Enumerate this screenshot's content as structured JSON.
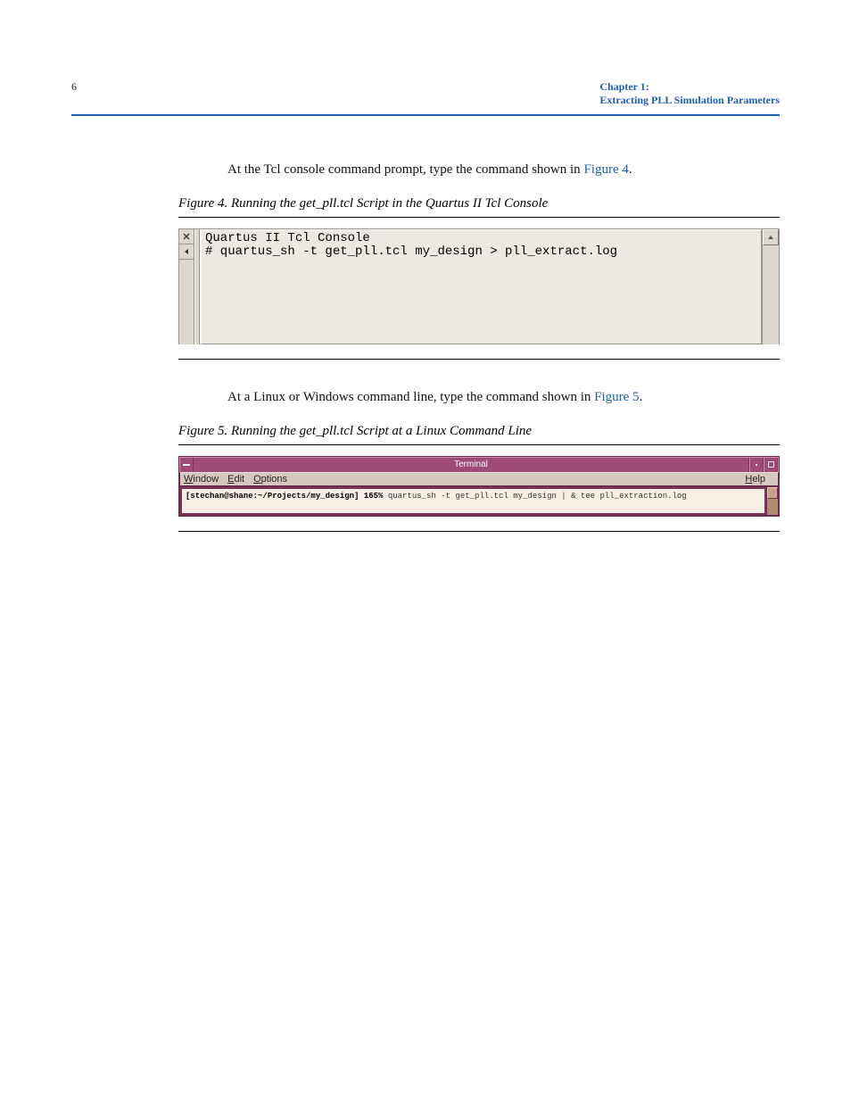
{
  "header": {
    "left": "6",
    "right_chapter": "Chapter 1:",
    "right_sub": "Extracting PLL Simulation Parameters"
  },
  "paragraphs": {
    "p1_a": "At the Tcl console command prompt, type the command shown in ",
    "p1_link": "Figure 4",
    "p1_b": ".",
    "p2_a": "At a Linux or Windows command line, type the command shown in ",
    "p2_link": "Figure 5",
    "p2_b": "."
  },
  "figures": {
    "fig4": {
      "caption": "Figure 4. Running the get_pll.tcl Script in the Quartus II Tcl Console",
      "console": {
        "line1": "Quartus II Tcl Console",
        "line2": "# quartus_sh -t get_pll.tcl my_design > pll_extract.log"
      }
    },
    "fig5": {
      "caption": "Figure 5. Running the get_pll.tcl Script at a Linux Command Line",
      "title": "Terminal",
      "menu": {
        "window": "Window",
        "edit": "Edit",
        "options": "Options",
        "help": "Help"
      },
      "prompt_bold": "[stechan@shane:~/Projects/my_design] 165%",
      "prompt_cmd": " quartus_sh -t get_pll.tcl my_design | & tee pll_extraction.log"
    }
  }
}
